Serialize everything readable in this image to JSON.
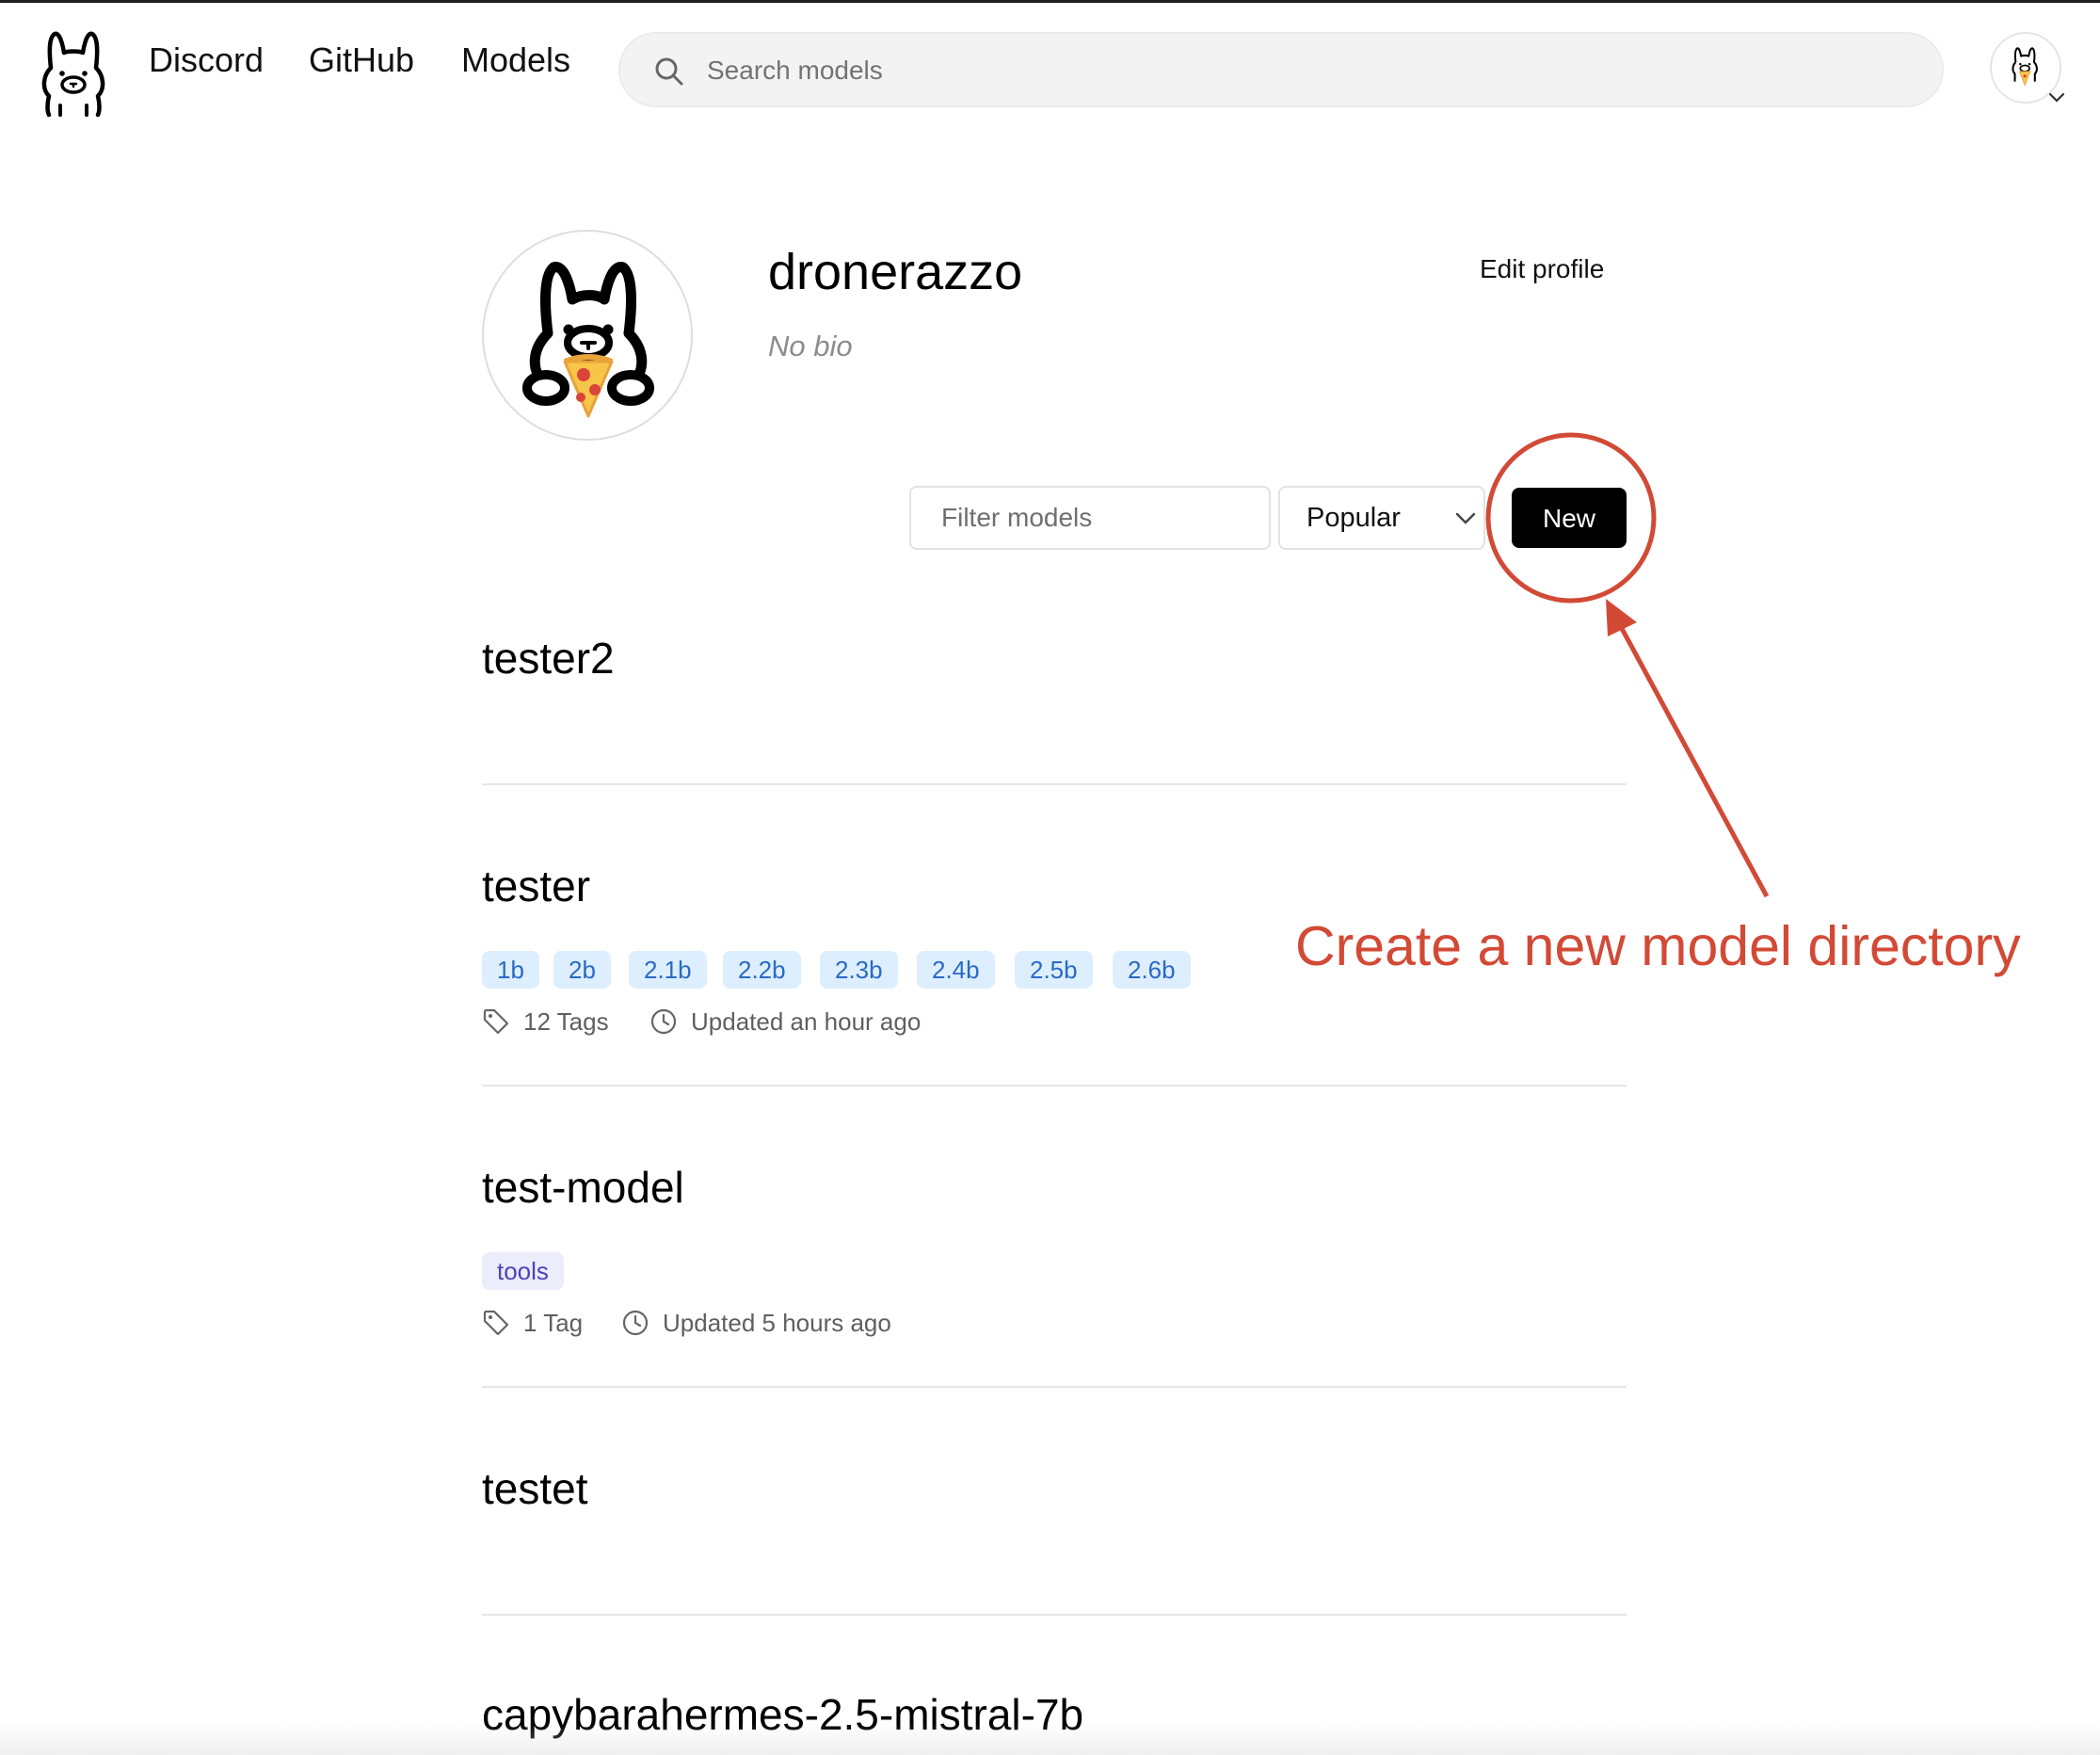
{
  "header": {
    "logo_icon": "ollama-llama-icon",
    "nav": {
      "discord": "Discord",
      "github": "GitHub",
      "models": "Models"
    },
    "search": {
      "placeholder": "Search models",
      "icon": "search-icon"
    },
    "user_avatar_icon": "llama-pizza-avatar-icon"
  },
  "profile": {
    "username": "dronerazzo",
    "bio": "No bio",
    "edit_label": "Edit profile"
  },
  "controls": {
    "filter_placeholder": "Filter models",
    "sort_selected": "Popular",
    "new_label": "New"
  },
  "annotation": {
    "text": "Create a new model directory",
    "color": "#d24a36"
  },
  "models": [
    {
      "name": "tester2"
    },
    {
      "name": "tester",
      "sizes": [
        "1b",
        "2b",
        "2.1b",
        "2.2b",
        "2.3b",
        "2.4b",
        "2.5b",
        "2.6b"
      ],
      "tags_count": "12 Tags",
      "updated": "Updated an hour ago"
    },
    {
      "name": "test-model",
      "capabilities": [
        "tools"
      ],
      "tags_count": "1 Tag",
      "updated": "Updated 5 hours ago"
    },
    {
      "name": "testet"
    },
    {
      "name": "capybarahermes-2.5-mistral-7b"
    }
  ]
}
